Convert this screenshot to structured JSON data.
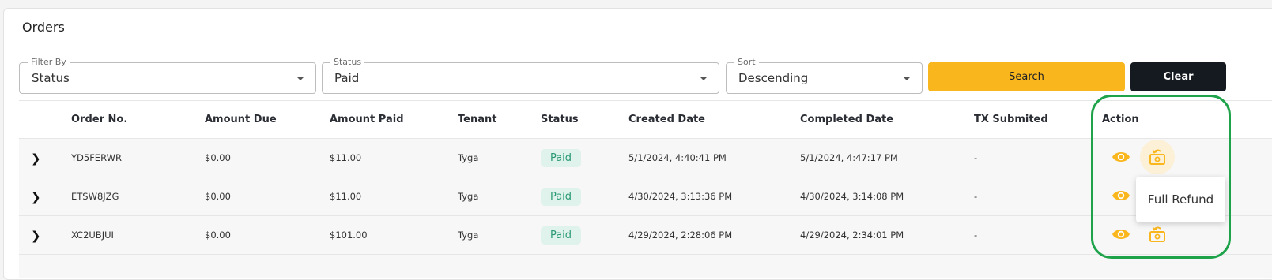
{
  "page": {
    "title": "Orders"
  },
  "filters": {
    "filter_by": {
      "label": "Filter By",
      "value": "Status"
    },
    "status": {
      "label": "Status",
      "value": "Paid"
    },
    "sort": {
      "label": "Sort",
      "value": "Descending"
    },
    "search_label": "Search",
    "clear_label": "Clear"
  },
  "table": {
    "headers": [
      "Order No.",
      "Amount Due",
      "Amount Paid",
      "Tenant",
      "Status",
      "Created Date",
      "Completed Date",
      "TX Submited",
      "Action"
    ],
    "rows": [
      {
        "order_no": "YD5FERWR",
        "amount_due": "$0.00",
        "amount_paid": "$11.00",
        "tenant": "Tyga",
        "status": "Paid",
        "created": "5/1/2024, 4:40:41 PM",
        "completed": "5/1/2024, 4:47:17 PM",
        "tx": "-"
      },
      {
        "order_no": "ETSW8JZG",
        "amount_due": "$0.00",
        "amount_paid": "$11.00",
        "tenant": "Tyga",
        "status": "Paid",
        "created": "4/30/2024, 3:13:36 PM",
        "completed": "4/30/2024, 3:14:08 PM",
        "tx": "-"
      },
      {
        "order_no": "XC2UBJUI",
        "amount_due": "$0.00",
        "amount_paid": "$101.00",
        "tenant": "Tyga",
        "status": "Paid",
        "created": "4/29/2024, 2:28:06 PM",
        "completed": "4/29/2024, 2:34:01 PM",
        "tx": "-"
      }
    ]
  },
  "tooltip": {
    "text": "Full Refund"
  },
  "colors": {
    "accent": "#f9b61d",
    "dark": "#151a20",
    "paid_bg": "#dff2ec",
    "paid_text": "#2a9a73",
    "highlight": "#1ea34a"
  },
  "icons": {
    "expand": "chevron-right-icon",
    "view": "eye-icon",
    "refund": "refund-icon",
    "dropdown": "caret-down-icon"
  }
}
